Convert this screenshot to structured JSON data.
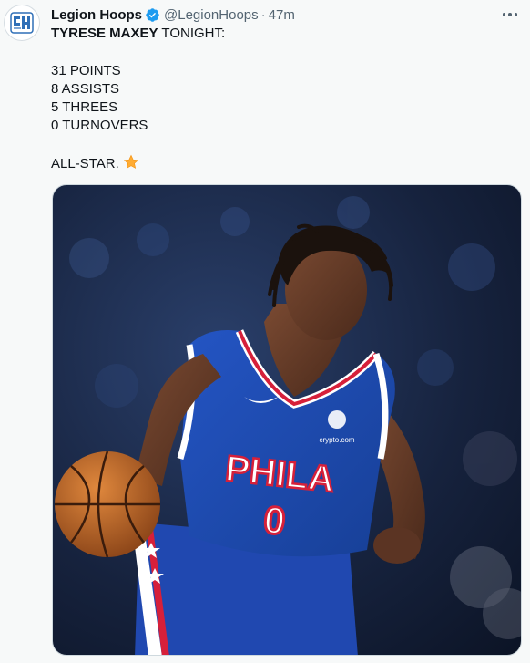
{
  "account": {
    "display_name": "Legion Hoops",
    "handle": "@LegionHoops",
    "separator": "·",
    "time": "47m",
    "verified_icon": "verified-badge-icon",
    "avatar_icon": "legion-hoops-logo"
  },
  "tweet": {
    "headline_bold": "TYRESE MAXEY",
    "headline_rest": " TONIGHT:",
    "stats": [
      "31 POINTS",
      "8 ASSISTS",
      "5 THREES",
      "0 TURNOVERS"
    ],
    "closing": "ALL-STAR.",
    "closing_icon": "star-emoji-icon"
  },
  "media": {
    "jersey_text": "PHILA",
    "jersey_number": "0",
    "sponsor_text": "crypto.com"
  },
  "colors": {
    "accent_blue": "#1d9bf0",
    "jersey_blue": "#1d4fb8",
    "jersey_red": "#d6203a"
  }
}
